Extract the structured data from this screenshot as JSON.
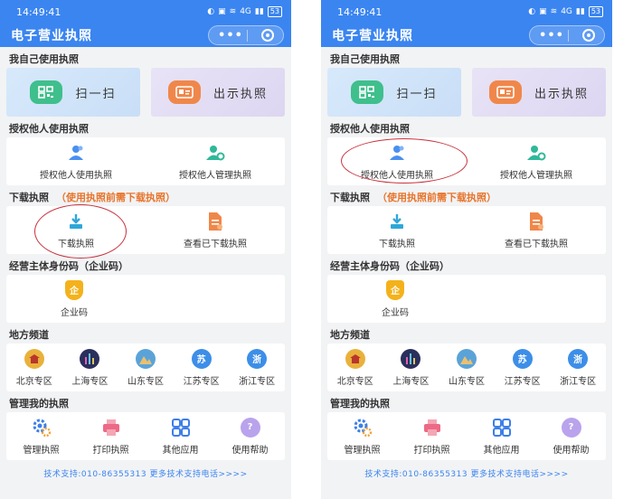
{
  "screens": [
    {
      "status": {
        "time": "14:49:41",
        "net": "4G",
        "battery": "53"
      },
      "app_title": "电子营业执照",
      "capsule": {
        "dots": "•••"
      },
      "self_section": {
        "title": "我自己使用执照",
        "scan": "扫一扫",
        "show": "出示执照"
      },
      "auth_section": {
        "title": "授权他人使用执照",
        "items": [
          "授权他人使用执照",
          "授权他人管理执照"
        ]
      },
      "download_section": {
        "title": "下载执照",
        "note": "（使用执照前需下载执照）",
        "items": [
          "下载执照",
          "查看已下载执照"
        ]
      },
      "code_section": {
        "title": "经营主体身份码（企业码）",
        "item": "企业码",
        "icon_char": "企"
      },
      "region_section": {
        "title": "地方频道",
        "items": [
          "北京专区",
          "上海专区",
          "山东专区",
          "江苏专区",
          "浙江专区"
        ],
        "js_char": "苏",
        "zj_char": "浙"
      },
      "manage_section": {
        "title": "管理我的执照",
        "items": [
          "管理执照",
          "打印执照",
          "其他应用",
          "使用帮助"
        ]
      },
      "footer": "技术支持:010-86355313  更多技术支持电话>>>>"
    },
    {
      "status": {
        "time": "14:49:41",
        "net": "4G",
        "battery": "53"
      },
      "app_title": "电子营业执照",
      "capsule": {
        "dots": "•••"
      },
      "self_section": {
        "title": "我自己使用执照",
        "scan": "扫一扫",
        "show": "出示执照"
      },
      "auth_section": {
        "title": "授权他人使用执照",
        "items": [
          "授权他人使用执照",
          "授权他人管理执照"
        ]
      },
      "download_section": {
        "title": "下载执照",
        "note": "（使用执照前需下载执照）",
        "items": [
          "下载执照",
          "查看已下载执照"
        ]
      },
      "code_section": {
        "title": "经营主体身份码（企业码）",
        "item": "企业码",
        "icon_char": "企"
      },
      "region_section": {
        "title": "地方频道",
        "items": [
          "北京专区",
          "上海专区",
          "山东专区",
          "江苏专区",
          "浙江专区"
        ],
        "js_char": "苏",
        "zj_char": "浙"
      },
      "manage_section": {
        "title": "管理我的执照",
        "items": [
          "管理执照",
          "打印执照",
          "其他应用",
          "使用帮助"
        ]
      },
      "footer": "技术支持:010-86355313  更多技术支持电话>>>>"
    }
  ],
  "colors": {
    "header": "#3b85f0",
    "accent": "#e8742a",
    "annotation": "#c8323c"
  },
  "annotations": [
    {
      "screen": 0,
      "target": "下载执照",
      "shape": "ellipse"
    },
    {
      "screen": 1,
      "target": "授权他人使用执照",
      "shape": "ellipse"
    }
  ]
}
